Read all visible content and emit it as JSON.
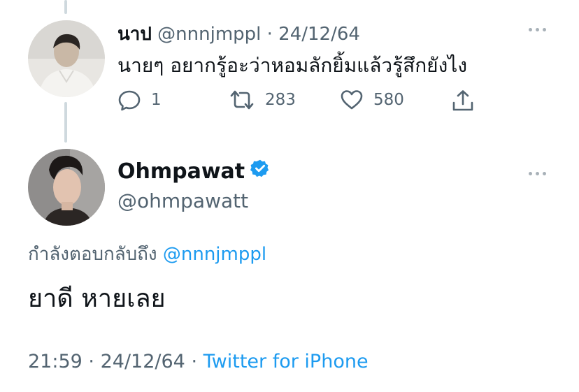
{
  "parent_tweet": {
    "display_name": "นาป",
    "handle": "@nnnjmppl",
    "separator": "·",
    "date": "24/12/64",
    "text": "นายๆ อยากรู้อะว่าหอมลักยิ้มแล้วรู้สึกยังไง",
    "actions": {
      "reply_icon": "reply-icon",
      "reply_count": "1",
      "retweet_icon": "retweet-icon",
      "retweet_count": "283",
      "like_icon": "heart-icon",
      "like_count": "580",
      "share_icon": "share-icon"
    }
  },
  "main_tweet": {
    "display_name": "Ohmpawat",
    "verified_icon": "verified-badge-icon",
    "handle": "@ohmpawatt",
    "replying_to_label": "กำลังตอบกลับถึง",
    "replying_to_handle": "@nnnjmppl",
    "text": "ยาดี หายเลย",
    "time": "21:59",
    "separator": "·",
    "date": "24/12/64",
    "separator2": "·",
    "source": "Twitter for iPhone"
  },
  "colors": {
    "link": "#1d9bf0",
    "muted": "#536471",
    "verified": "#1d9bf0",
    "thread_line": "#cfd9de"
  }
}
